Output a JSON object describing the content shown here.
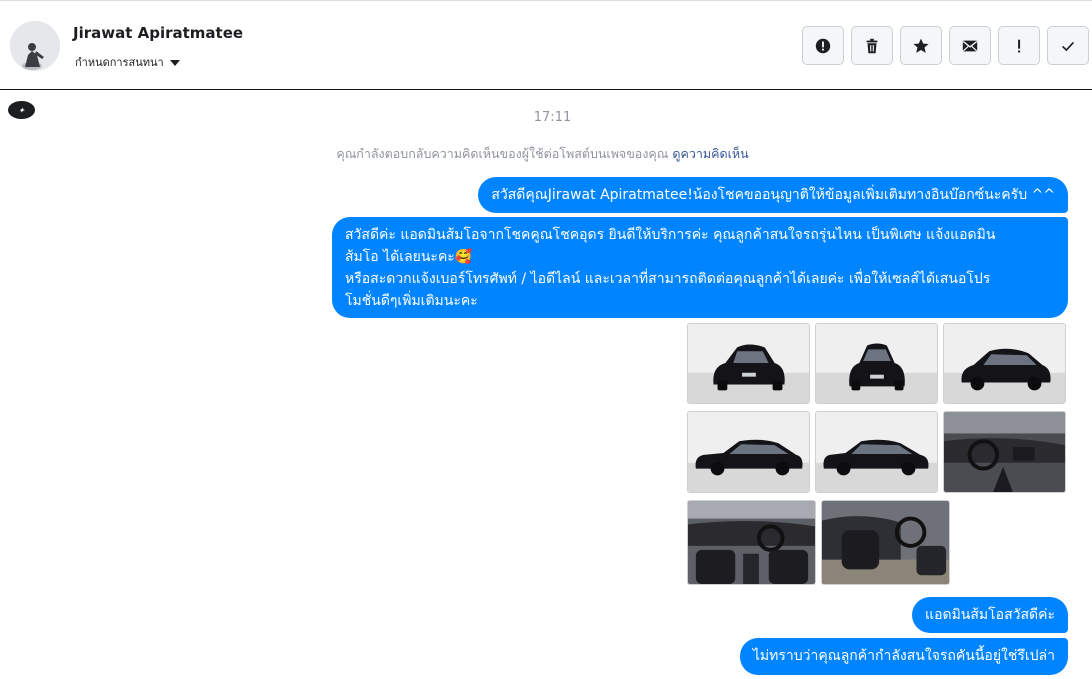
{
  "header": {
    "user_name": "Jirawat Apiratmatee",
    "assign_label": "กำหนดการสนทนา"
  },
  "actions": [
    {
      "name": "report-icon"
    },
    {
      "name": "trash-icon"
    },
    {
      "name": "star-icon"
    },
    {
      "name": "mail-icon"
    },
    {
      "name": "important-icon"
    },
    {
      "name": "check-icon"
    }
  ],
  "thread": {
    "timestamp": "17:11",
    "notice_text": "คุณกำลังตอบกลับความคิดเห็นของผู้ใช้ต่อโพสต์บนเพจของคุณ",
    "notice_link": "ดูความคิดเห็น"
  },
  "messages": {
    "m1": "สวัสดีคุณJirawat Apiratmatee!น้องโชคขออนุญาติให้ข้อมูลเพิ่มเติมทางอินบ๊อกซ์นะครับ ^^",
    "m2_line1": "สวัสดีค่ะ แอดมินส้มโอจากโชคคูณโชคอุดร ยินดีให้บริการค่ะ   คุณลูกค้าสนใจรถรุ่นไหน เป็นพิเศษ แจ้งแอดมิน",
    "m2_line2": "ส้มโอ ได้เลยนะคะ🥰",
    "m2_line3": "หรือสะดวกแจ้งเบอร์โทรศัพท์ / ไอดีไลน์ และเวลาที่สามารถติดต่อคุณลูกค้าได้เลยค่ะ เพื่อให้เซลส์ได้เสนอโปร",
    "m2_line4": "โมชั่นดีๆเพิ่มเติมนะคะ",
    "m3": "แอดมินส้มโอสวัสดีค่ะ",
    "m4": "ไม่ทราบว่าคุณลูกค้ากำลังสนใจรถคันนี้อยู่ใช่รึเปล่า"
  },
  "colors": {
    "bubble": "#0084ff",
    "car": "#141418",
    "floor": "#dcdcdc",
    "interior": "#2b2b2f"
  }
}
